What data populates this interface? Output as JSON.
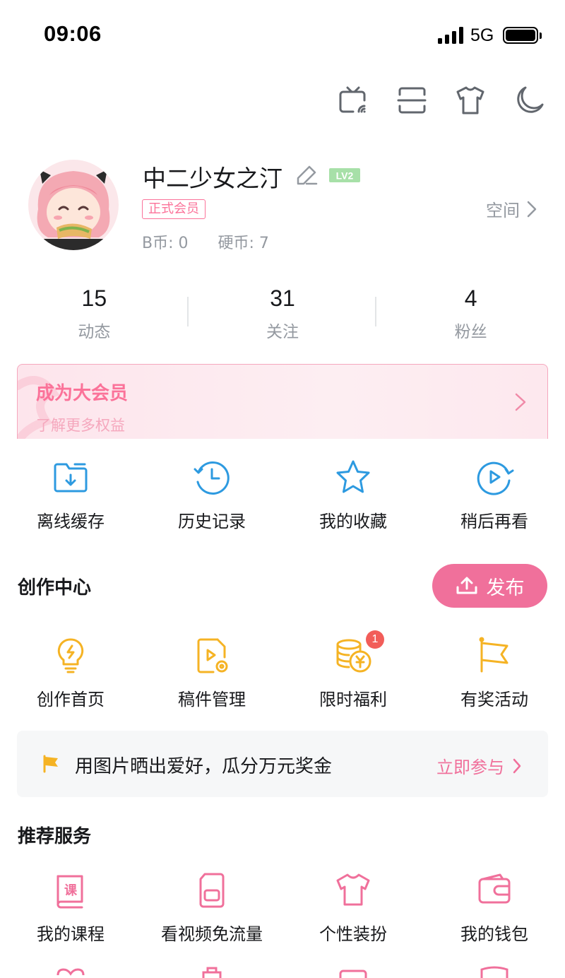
{
  "status_bar": {
    "time": "09:06",
    "network": "5G"
  },
  "toolbar": {
    "icons": [
      "tv-cast-icon",
      "scan-icon",
      "shirt-icon",
      "moon-icon"
    ]
  },
  "profile": {
    "username": "中二少女之汀",
    "level_badge": "LV2",
    "vip_tag": "正式会员",
    "b_coins": "B币: 0",
    "hard_coins": "硬币: 7",
    "space_link": "空间"
  },
  "stats": [
    {
      "value": "15",
      "label": "动态"
    },
    {
      "value": "31",
      "label": "关注"
    },
    {
      "value": "4",
      "label": "粉丝"
    }
  ],
  "vip_banner": {
    "title": "成为大会员",
    "subtitle": "了解更多权益"
  },
  "quick_actions": [
    {
      "label": "离线缓存",
      "icon": "download-folder-icon"
    },
    {
      "label": "历史记录",
      "icon": "history-clock-icon"
    },
    {
      "label": "我的收藏",
      "icon": "star-icon"
    },
    {
      "label": "稍后再看",
      "icon": "watch-later-icon"
    }
  ],
  "creation_center": {
    "title": "创作中心",
    "publish_label": "发布",
    "items": [
      {
        "label": "创作首页",
        "icon": "lightbulb-icon"
      },
      {
        "label": "稿件管理",
        "icon": "manuscript-icon"
      },
      {
        "label": "限时福利",
        "icon": "coins-icon",
        "badge": "1"
      },
      {
        "label": "有奖活动",
        "icon": "flag-icon"
      }
    ]
  },
  "promo": {
    "text": "用图片晒出爱好，瓜分万元奖金",
    "link": "立即参与"
  },
  "services": {
    "title": "推荐服务",
    "items": [
      {
        "label": "我的课程",
        "icon": "course-book-icon"
      },
      {
        "label": "看视频免流量",
        "icon": "sim-card-icon"
      },
      {
        "label": "个性装扮",
        "icon": "tshirt-icon"
      },
      {
        "label": "我的钱包",
        "icon": "wallet-icon"
      }
    ]
  },
  "colors": {
    "pink": "#fb7299",
    "blue": "#2d9ae0",
    "gold": "#f5b324",
    "gray_text": "#9499a0"
  }
}
